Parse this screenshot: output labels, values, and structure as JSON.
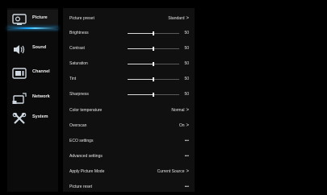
{
  "sidebar": {
    "items": [
      {
        "label": "Picture",
        "icon": "picture-icon",
        "active": true
      },
      {
        "label": "Sound",
        "icon": "speaker-icon",
        "active": false
      },
      {
        "label": "Channel",
        "icon": "channel-icon",
        "active": false
      },
      {
        "label": "Network",
        "icon": "network-icon",
        "active": false
      },
      {
        "label": "System",
        "icon": "system-tools-icon",
        "active": false
      }
    ]
  },
  "menu": {
    "rows": [
      {
        "label": "Picture preset",
        "value": "Standard",
        "chevron": ">"
      },
      {
        "label": "Brightness",
        "slider": 50
      },
      {
        "label": "Contrast",
        "slider": 50
      },
      {
        "label": "Saturation",
        "slider": 50
      },
      {
        "label": "Tint",
        "slider": 50
      },
      {
        "label": "Sharpness",
        "slider": 50
      },
      {
        "label": "Color temperature",
        "value": "Normal",
        "chevron": ">"
      },
      {
        "label": "Overscan",
        "value": "On",
        "chevron": ">"
      },
      {
        "label": "ECO settings",
        "value": "•••"
      },
      {
        "label": "Advanced settings",
        "value": "•••"
      },
      {
        "label": "Apply Picture Mode",
        "value": "Current Source",
        "chevron": ">"
      },
      {
        "label": "Picture reset",
        "value": "•••"
      }
    ]
  },
  "colors": {
    "accent": "#1ba8ff",
    "panel": "#101010",
    "background": "#000000"
  }
}
